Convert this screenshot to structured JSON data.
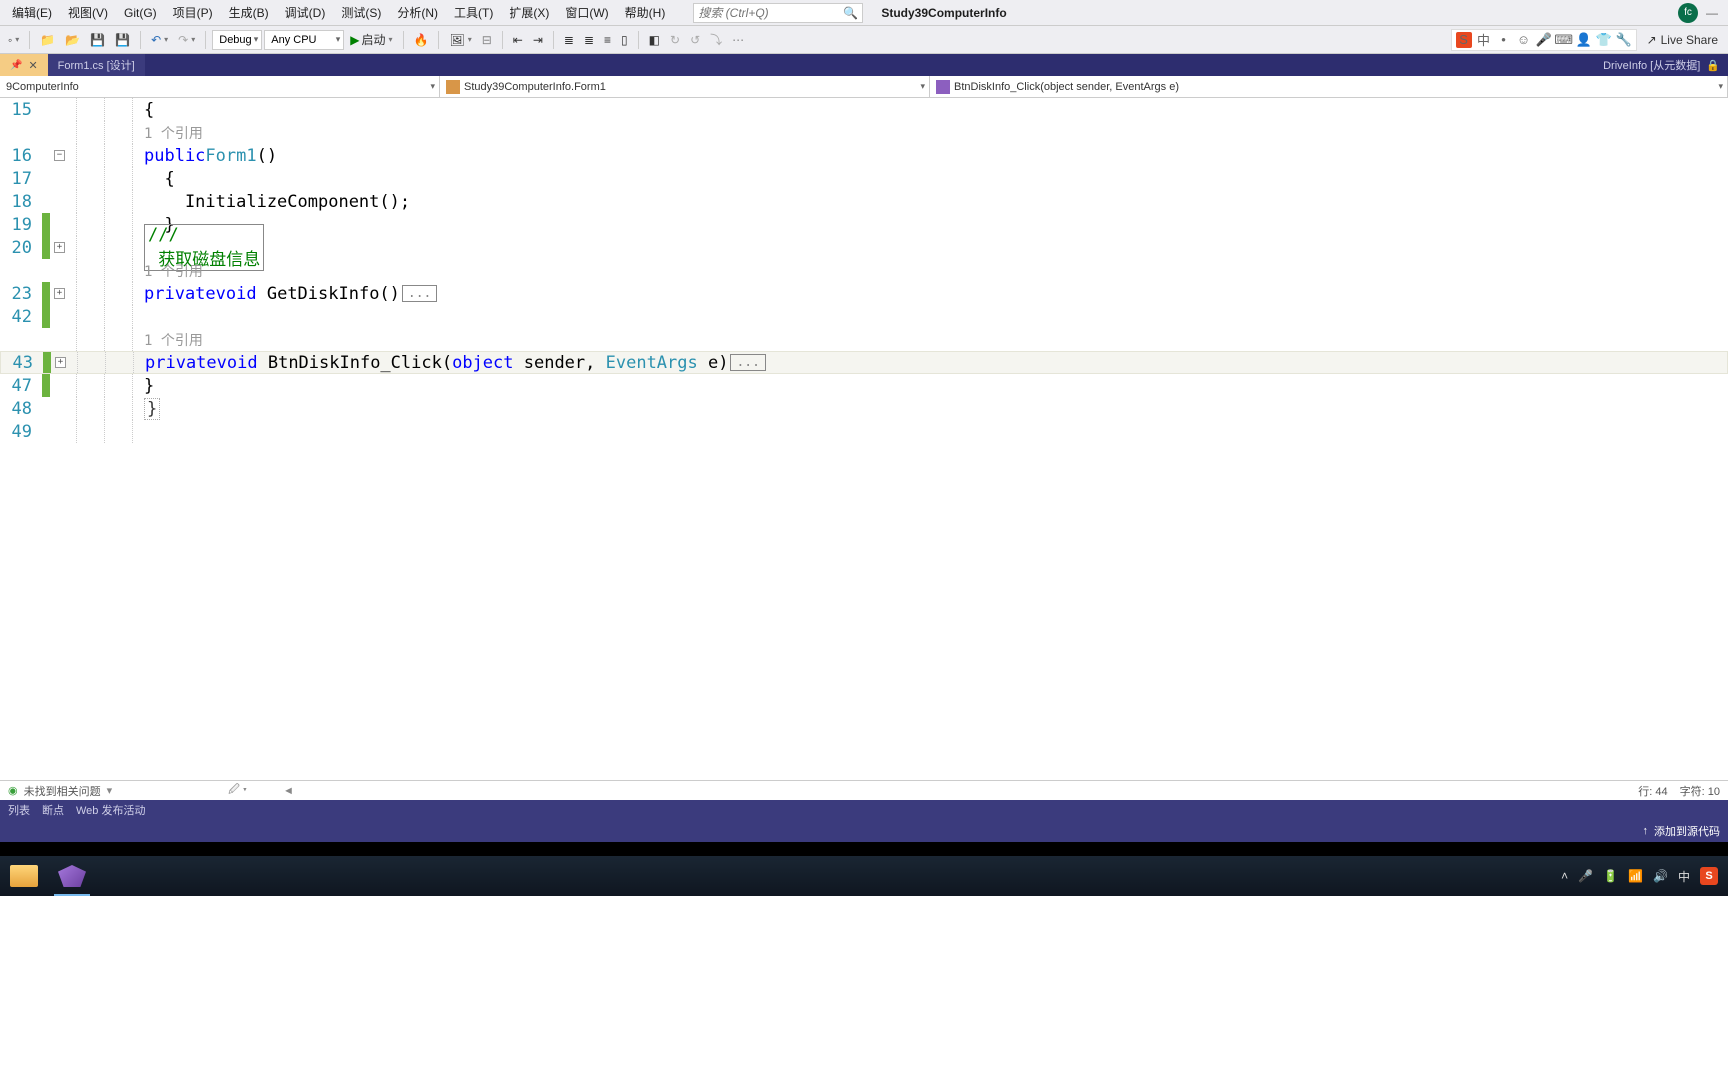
{
  "menubar": {
    "items": [
      "编辑(E)",
      "视图(V)",
      "Git(G)",
      "项目(P)",
      "生成(B)",
      "调试(D)",
      "测试(S)",
      "分析(N)",
      "工具(T)",
      "扩展(X)",
      "窗口(W)",
      "帮助(H)"
    ],
    "search_placeholder": "搜索 (Ctrl+Q)",
    "solution_name": "Study39ComputerInfo",
    "avatar_initial": "fc",
    "minimize": "—"
  },
  "toolbar": {
    "config": "Debug",
    "platform": "Any CPU",
    "start_label": "启动",
    "live_share": "Live Share",
    "ime_lang": "中"
  },
  "tabs": {
    "active": "Form1.cs [设计]",
    "right_label": "DriveInfo [从元数据]"
  },
  "nav": {
    "scope": "9ComputerInfo",
    "class": "Study39ComputerInfo.Form1",
    "member": "BtnDiskInfo_Click(object sender, EventArgs e)"
  },
  "code": {
    "lines": [
      {
        "num": "15",
        "text": "{",
        "indent": 1
      },
      {
        "num": "",
        "text": "1 个引用",
        "ref": true,
        "indent": 2
      },
      {
        "num": "16",
        "fold": "-",
        "kw": "public",
        "type": "Form1",
        "after": "()",
        "indent": 2
      },
      {
        "num": "17",
        "text": "{",
        "indent": 2
      },
      {
        "num": "18",
        "text": "InitializeComponent();",
        "indent": 3
      },
      {
        "num": "19",
        "text": "}",
        "green": true,
        "indent": 2
      },
      {
        "num": "20",
        "fold": "+",
        "green": true,
        "summary": "/// <summary> 获取磁盘信息",
        "indent": 2
      },
      {
        "num": "",
        "text": "1 个引用",
        "ref": true,
        "indent": 2
      },
      {
        "num": "23",
        "fold": "+",
        "green": true,
        "kw": "private",
        "kw2": "void",
        "method": "GetDiskInfo",
        "after": "()",
        "ellipsis": true,
        "indent": 2
      },
      {
        "num": "42",
        "text": "",
        "green": true,
        "indent": 2
      },
      {
        "num": "",
        "text": "1 个引用",
        "ref": true,
        "indent": 2
      },
      {
        "num": "43",
        "fold": "+",
        "green": true,
        "highlight": true,
        "kw": "private",
        "kw2": "void",
        "method": "BtnDiskInfo_Click",
        "sig_open": "(",
        "p1kw": "object",
        "p1": "sender, ",
        "p2type": "EventArgs",
        "p2": " e)",
        "ellipsis": true,
        "indent": 2
      },
      {
        "num": "47",
        "text": "}",
        "green": true,
        "indent": 1
      },
      {
        "num": "48",
        "bracket_close": "}",
        "indent": 0
      },
      {
        "num": "49",
        "text": "",
        "indent": 0
      }
    ]
  },
  "problems": {
    "msg": "未找到相关问题",
    "line_label": "行: 44",
    "char_label": "字符: 10"
  },
  "bottom_tabs": [
    "列表",
    "断点",
    "Web 发布活动"
  ],
  "status": {
    "add_source": "添加到源代码"
  },
  "systray": {
    "lang": "中"
  }
}
